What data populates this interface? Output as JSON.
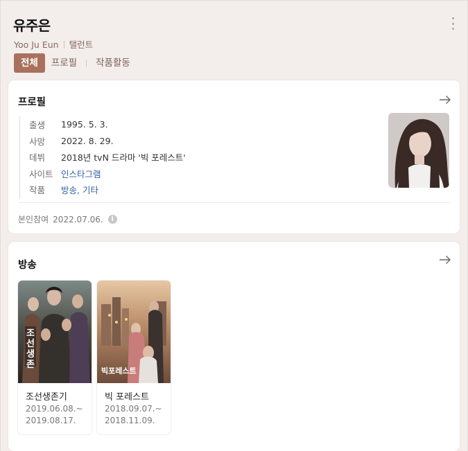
{
  "person": {
    "name": "유주은",
    "english_name": "Yoo Ju Eun",
    "occupation": "탤런트"
  },
  "tabs": [
    {
      "label": "전체",
      "active": true
    },
    {
      "label": "프로필",
      "active": false
    },
    {
      "label": "작품활동",
      "active": false
    }
  ],
  "profile": {
    "title": "프로필",
    "rows": [
      {
        "label": "출생",
        "value": "1995. 5. 3."
      },
      {
        "label": "사망",
        "value": "2022. 8. 29."
      },
      {
        "label": "데뷔",
        "value": "2018년 tvN 드라마 '빅 포레스트'"
      },
      {
        "label": "사이트",
        "value": "인스타그램"
      },
      {
        "label": "작품",
        "value": "방송, 기타"
      }
    ],
    "footer_label": "본인참여",
    "footer_date": "2022.07.06."
  },
  "broadcast": {
    "title": "방송",
    "works": [
      {
        "title": "조선생존기",
        "start": "2019.06.08.~",
        "end": "2019.08.17.",
        "poster_text": "조선생존기"
      },
      {
        "title": "빅 포레스트",
        "start": "2018.09.07.~",
        "end": "2018.11.09.",
        "poster_text": "빅포레스트"
      }
    ]
  },
  "icons": [
    "more-vertical-icon",
    "arrow-right-icon",
    "info-icon"
  ],
  "colors": {
    "accent": "#a9715d",
    "link": "#2f5fa6",
    "background": "#f3eeeb"
  }
}
